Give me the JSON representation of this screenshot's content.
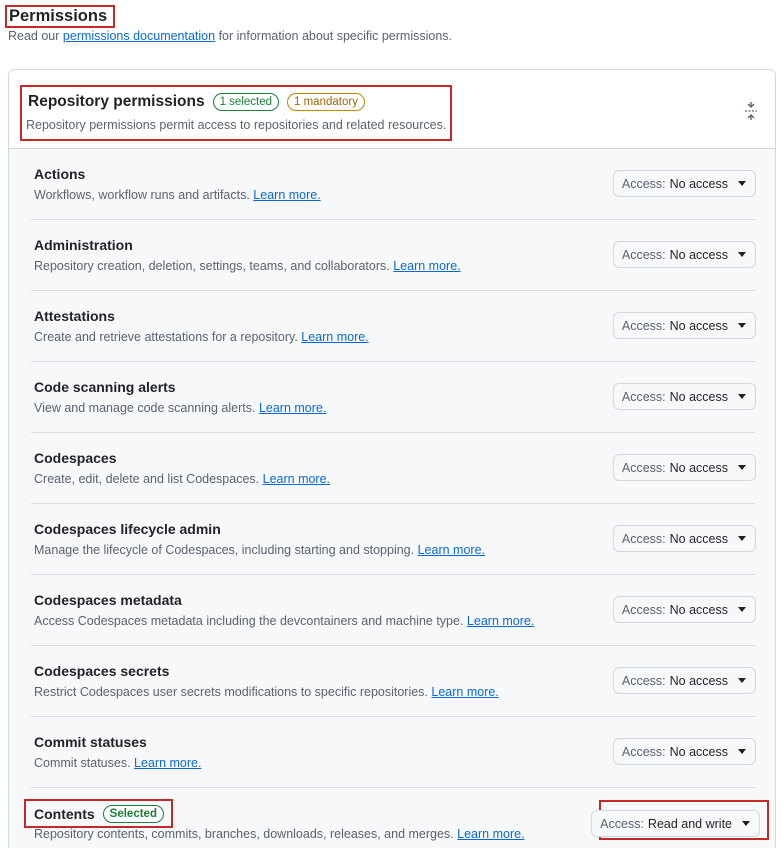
{
  "page": {
    "title": "Permissions",
    "intro_prefix": "Read our",
    "intro_link": "permissions documentation",
    "intro_suffix": "for information about specific permissions."
  },
  "section": {
    "title": "Repository permissions",
    "selected_badge": "1 selected",
    "mandatory_badge": "1 mandatory",
    "description": "Repository permissions permit access to repositories and related resources."
  },
  "access_prefix": "Access:",
  "learn_more": "Learn more.",
  "permissions": [
    {
      "name": "Actions",
      "description": "Workflows, workflow runs and artifacts.",
      "access": "No access"
    },
    {
      "name": "Administration",
      "description": "Repository creation, deletion, settings, teams, and collaborators.",
      "access": "No access"
    },
    {
      "name": "Attestations",
      "description": "Create and retrieve attestations for a repository.",
      "access": "No access"
    },
    {
      "name": "Code scanning alerts",
      "description": "View and manage code scanning alerts.",
      "access": "No access"
    },
    {
      "name": "Codespaces",
      "description": "Create, edit, delete and list Codespaces.",
      "access": "No access"
    },
    {
      "name": "Codespaces lifecycle admin",
      "description": "Manage the lifecycle of Codespaces, including starting and stopping.",
      "access": "No access"
    },
    {
      "name": "Codespaces metadata",
      "description": "Access Codespaces metadata including the devcontainers and machine type.",
      "access": "No access"
    },
    {
      "name": "Codespaces secrets",
      "description": "Restrict Codespaces user secrets modifications to specific repositories.",
      "access": "No access"
    },
    {
      "name": "Commit statuses",
      "description": "Commit statuses.",
      "access": "No access"
    },
    {
      "name": "Contents",
      "badge": "Selected",
      "description": "Repository contents, commits, branches, downloads, releases, and merges.",
      "access": "Read and write"
    }
  ],
  "colors": {
    "link": "#0969da",
    "selected_badge": "#1a7f37",
    "mandatory_badge": "#9a6700",
    "highlight_box": "#c62828"
  }
}
